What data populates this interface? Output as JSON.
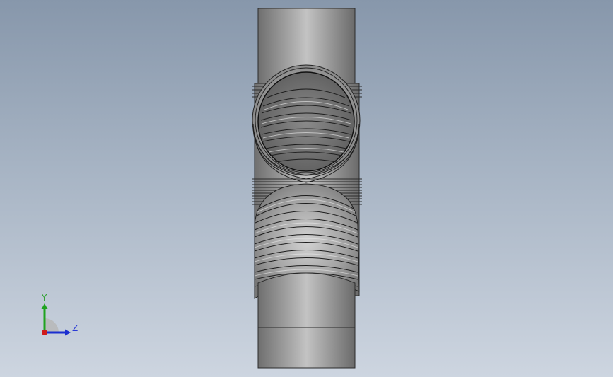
{
  "triad": {
    "y_label": "Y",
    "z_label": "Z",
    "colors": {
      "y_axis": "#1fa31f",
      "z_axis": "#1b2fd0",
      "x_axis": "#d01b1b"
    }
  },
  "model": {
    "icon": "corrugated-pipe-tee-model",
    "color_body": "#9b9b9b"
  }
}
